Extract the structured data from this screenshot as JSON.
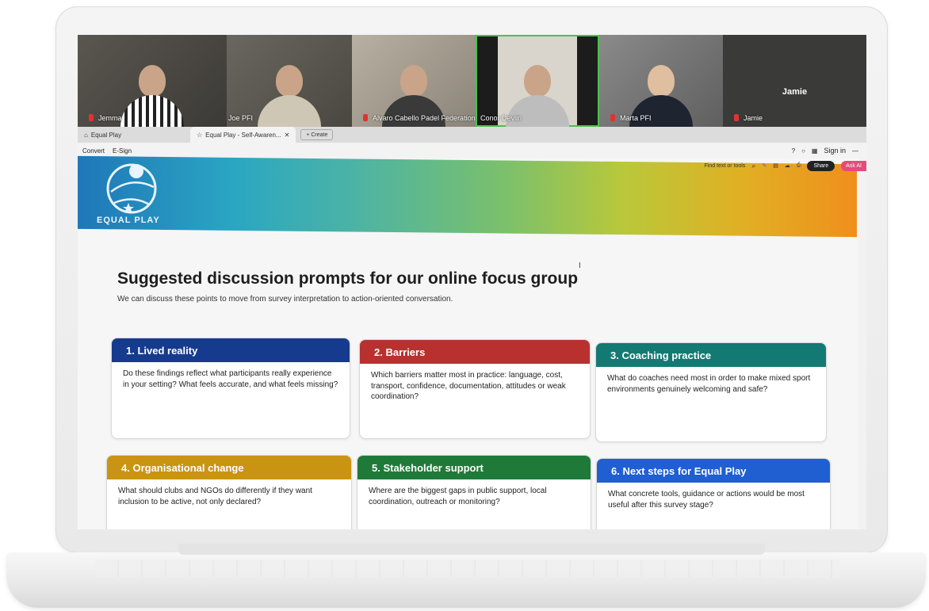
{
  "video_call": {
    "participants": [
      {
        "name": "Jemma",
        "muted": true
      },
      {
        "name": "Joe PFI",
        "muted": false
      },
      {
        "name": "Alvaro Cabello Padel Federation",
        "muted": true
      },
      {
        "name": "Conor Devlin",
        "muted": false,
        "active": true
      },
      {
        "name": "Marta PFI",
        "muted": true
      },
      {
        "name": "Jamie",
        "muted": true
      }
    ],
    "big_name": "Jamie"
  },
  "browser": {
    "tabs": [
      {
        "label": "Equal Play"
      },
      {
        "label": "Equal Play - Self-Awaren..."
      }
    ],
    "new_tab_label": "+ Create",
    "toolbar": {
      "convert": "Convert",
      "esign": "E-Sign",
      "sign_in": "Sign in"
    },
    "find_placeholder": "Find text or tools",
    "share_label": "Share",
    "ask_ai_label": "Ask AI"
  },
  "doc": {
    "logo_text": "EQUAL PLAY",
    "heading": "Suggested discussion prompts for our online focus group",
    "subheading": "We can discuss these points to move from survey interpretation to action-oriented conversation.",
    "cards": [
      {
        "title": "1. Lived reality",
        "color": "#163b8e",
        "body": "Do these findings reflect what participants really experience in your setting? What feels accurate, and what feels missing?"
      },
      {
        "title": "2. Barriers",
        "color": "#b8312f",
        "body": "Which barriers matter most in practice: language, cost, transport, confidence, documentation, attitudes or weak coordination?"
      },
      {
        "title": "3. Coaching practice",
        "color": "#127a72",
        "body": "What do coaches need most in order to make mixed sport environments genuinely welcoming and safe?"
      },
      {
        "title": "4. Organisational change",
        "color": "#c99412",
        "body": "What should clubs and NGOs do differently if they want inclusion to be active, not only declared?"
      },
      {
        "title": "5. Stakeholder support",
        "color": "#1f7a3a",
        "body": "Where are the biggest gaps in public support, local coordination, outreach or monitoring?"
      },
      {
        "title": "6. Next steps for Equal Play",
        "color": "#1f5fd1",
        "body": "What concrete tools, guidance or actions would be most useful after this survey stage?"
      }
    ]
  }
}
